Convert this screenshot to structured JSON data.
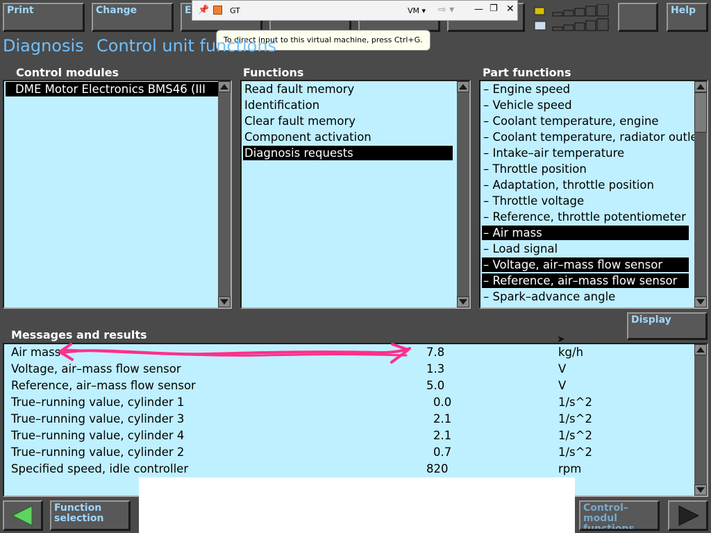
{
  "colors": {
    "list_bg": "#bff0ff",
    "accent": "#6fbfff",
    "annotation": "#ff2f8a",
    "background": "#4a4a4a"
  },
  "toolbar": {
    "print": "Print",
    "change": "Change",
    "e_partial": "E",
    "help": "Help"
  },
  "vm": {
    "pin_icon": "pin-icon",
    "app_icon": "vm-app-icon",
    "name": "GT",
    "vm_menu": "VM",
    "tooltip": "To direct input to this virtual machine, press Ctrl+G."
  },
  "header": {
    "title": "Diagnosis",
    "subtitle": "Control unit functions"
  },
  "control_modules": {
    "label": "Control modules",
    "items": [
      "DME Motor Electronics BMS46 (III"
    ],
    "selected_index": 0
  },
  "functions": {
    "label": "Functions",
    "items": [
      "Read fault memory",
      "Identification",
      "Clear fault memory",
      "Component activation",
      "Diagnosis requests"
    ],
    "selected_index": 4
  },
  "part_functions": {
    "label": "Part functions",
    "items": [
      "– Engine speed",
      "– Vehicle speed",
      "– Coolant temperature, engine",
      "– Coolant temperature, radiator outle",
      "– Intake–air temperature",
      "– Throttle position",
      "– Adaptation, throttle position",
      "– Throttle voltage",
      "– Reference, throttle potentiometer",
      "– Air mass",
      "– Load signal",
      "– Voltage, air–mass flow sensor",
      "– Reference, air–mass flow sensor",
      "– Spark–advance angle"
    ],
    "selected": [
      9,
      11,
      12
    ]
  },
  "display_button": "Display",
  "results": {
    "label": "Messages and results",
    "rows": [
      {
        "name": "Air mass",
        "value": "7.8",
        "unit": "kg/h"
      },
      {
        "name": "Voltage, air–mass flow sensor",
        "value": "1.3",
        "unit": "V"
      },
      {
        "name": "Reference, air–mass flow sensor",
        "value": "5.0",
        "unit": "V"
      },
      {
        "name": "True–running value, cylinder 1",
        "value": "0.0",
        "unit": "1/s^2"
      },
      {
        "name": "True–running value, cylinder 3",
        "value": "2.1",
        "unit": "1/s^2"
      },
      {
        "name": "True–running value, cylinder 4",
        "value": "2.1",
        "unit": "1/s^2"
      },
      {
        "name": "True–running value, cylinder 2",
        "value": "0.7",
        "unit": "1/s^2"
      },
      {
        "name": "Specified speed, idle controller",
        "value": "820",
        "unit": "rpm"
      }
    ]
  },
  "bottom_nav": {
    "back_icon": "left-arrow-icon",
    "function_selection": "Function selection",
    "control_module_functions": "Control–modul functions",
    "forward_icon": "right-arrow-icon"
  }
}
